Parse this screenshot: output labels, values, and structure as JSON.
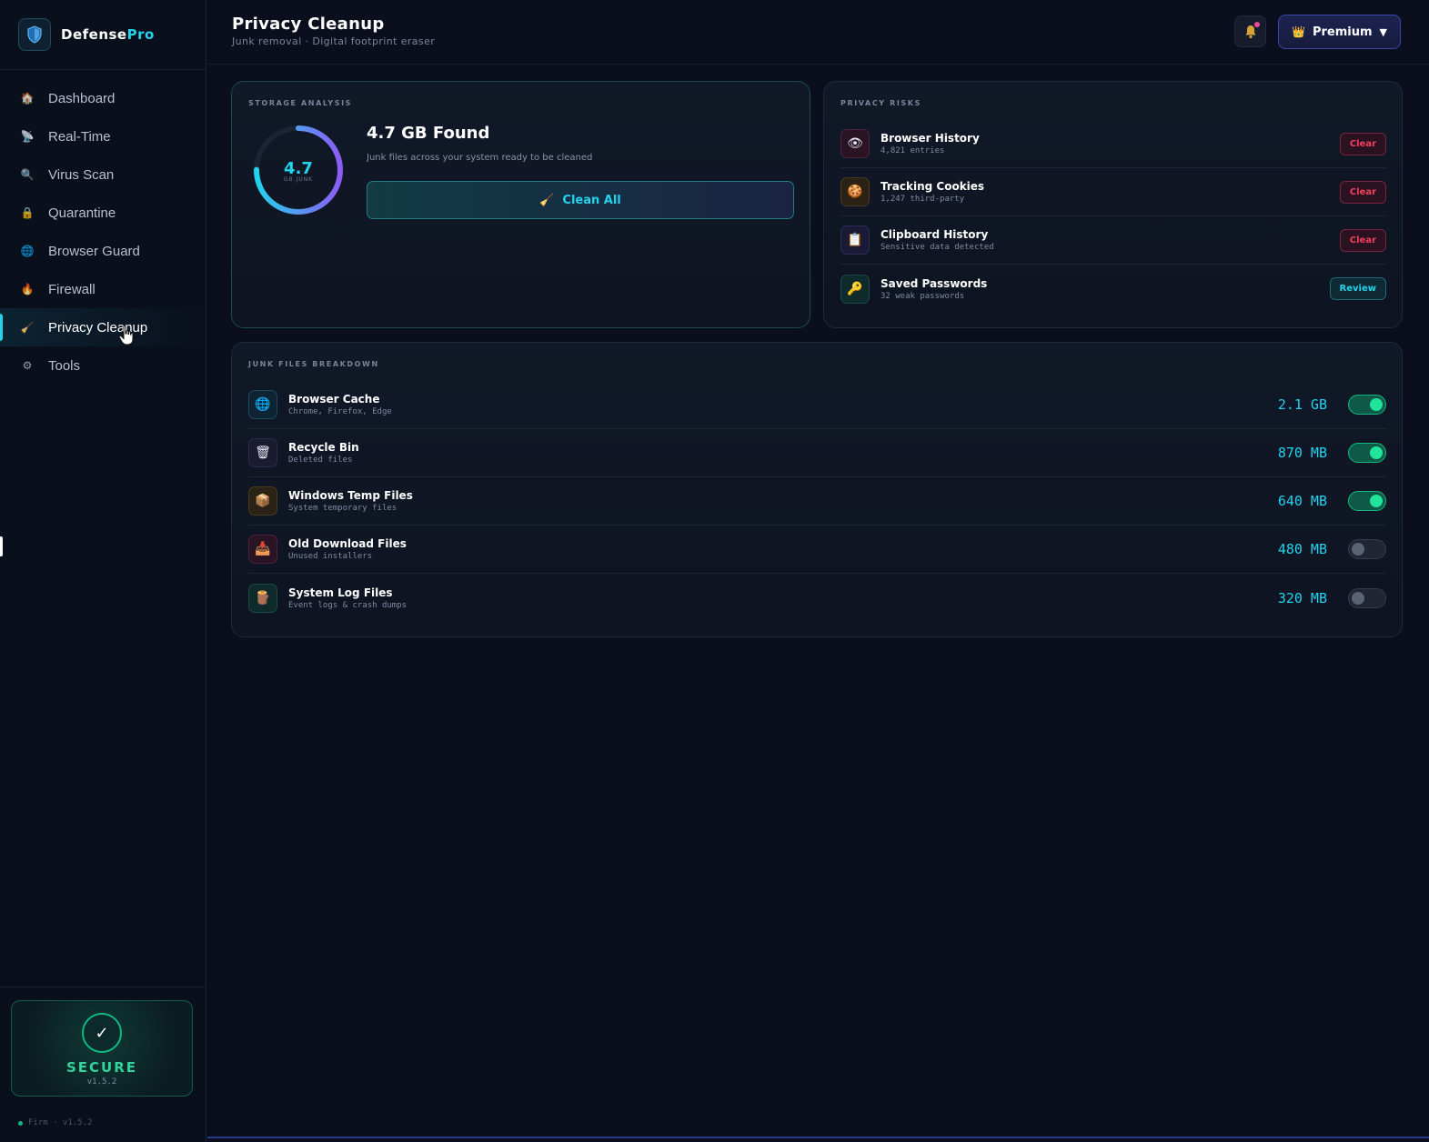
{
  "brand": {
    "name_main": "Defense",
    "name_accent": "Pro"
  },
  "sidebar": {
    "items": [
      {
        "label": "Dashboard",
        "icon": "home-icon",
        "glyph": "🏠"
      },
      {
        "label": "Real-Time",
        "icon": "real-time-icon",
        "glyph": "📡"
      },
      {
        "label": "Virus Scan",
        "icon": "search-icon",
        "glyph": "🔍"
      },
      {
        "label": "Quarantine",
        "icon": "lock-icon",
        "glyph": "🔒"
      },
      {
        "label": "Browser Guard",
        "icon": "globe-icon",
        "glyph": "🌐"
      },
      {
        "label": "Firewall",
        "icon": "fire-icon",
        "glyph": "🔥"
      },
      {
        "label": "Privacy Cleanup",
        "icon": "broom-icon",
        "glyph": "🧹",
        "active": true
      },
      {
        "label": "Tools",
        "icon": "gear-icon",
        "glyph": "⚙"
      }
    ],
    "status": {
      "text": "SECURE",
      "version": "v1.5.2",
      "check": "✓"
    },
    "footer": {
      "text": "Firm · v1.5.2"
    }
  },
  "header": {
    "title": "Privacy Cleanup",
    "subtitle": "Junk removal · Digital footprint eraser",
    "premium_label": "Premium",
    "premium_caret": "▼",
    "premium_crown": "👑"
  },
  "storage": {
    "label": "STORAGE ANALYSIS",
    "gauge_value": "4.7",
    "gauge_unit": "GB JUNK",
    "gauge_fill": 0.75,
    "found_title": "4.7 GB Found",
    "found_subtitle": "Junk files across your system ready to be cleaned",
    "clean_button": "Clean All",
    "clean_icon": "🧹"
  },
  "privacy_risks": {
    "label": "PRIVACY RISKS",
    "items": [
      {
        "title": "Browser History",
        "subtitle": "4,821 entries",
        "action": "Clear",
        "icon": "eye-icon",
        "glyph": "👁"
      },
      {
        "title": "Tracking Cookies",
        "subtitle": "1,247 third-party",
        "action": "Clear",
        "icon": "cookie-icon",
        "glyph": "🍪"
      },
      {
        "title": "Clipboard History",
        "subtitle": "Sensitive data detected",
        "action": "Clear",
        "icon": "clipboard-icon",
        "glyph": "📋"
      },
      {
        "title": "Saved Passwords",
        "subtitle": "32 weak passwords",
        "action": "Review",
        "icon": "key-icon",
        "glyph": "🔑"
      }
    ]
  },
  "junk": {
    "label": "JUNK FILES BREAKDOWN",
    "items": [
      {
        "title": "Browser Cache",
        "subtitle": "Chrome, Firefox, Edge",
        "size": "2.1 GB",
        "enabled": true,
        "icon": "globe-icon",
        "glyph": "🌐"
      },
      {
        "title": "Recycle Bin",
        "subtitle": "Deleted files",
        "size": "870 MB",
        "enabled": true,
        "icon": "trash-icon",
        "glyph": "🗑"
      },
      {
        "title": "Windows Temp Files",
        "subtitle": "System temporary files",
        "size": "640 MB",
        "enabled": true,
        "icon": "package-icon",
        "glyph": "📦"
      },
      {
        "title": "Old Download Files",
        "subtitle": "Unused installers",
        "size": "480 MB",
        "enabled": false,
        "icon": "download-icon",
        "glyph": "📥"
      },
      {
        "title": "System Log Files",
        "subtitle": "Event logs & crash dumps",
        "size": "320 MB",
        "enabled": false,
        "icon": "log-icon",
        "glyph": "🪵"
      }
    ]
  },
  "colors": {
    "accent": "#22d3ee",
    "success": "#10b981",
    "danger": "#f43f5e",
    "background": "#0b0f1d"
  }
}
